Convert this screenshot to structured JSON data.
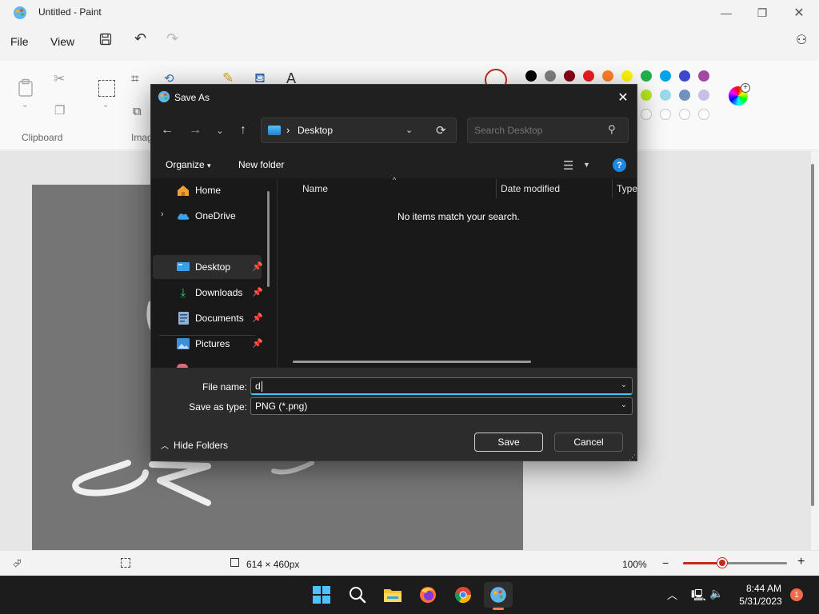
{
  "app": {
    "title": "Untitled - Paint"
  },
  "menu": {
    "file": "File",
    "view": "View"
  },
  "ribbon": {
    "clipboard_label": "Clipboard",
    "image_label": "Imag",
    "palette_row1": [
      "#000000",
      "#7f7f7f",
      "#880015",
      "#ed1c24",
      "#ff7f27",
      "#fff200",
      "#22b14c",
      "#00a2e8",
      "#3f48cc",
      "#a349a4"
    ],
    "palette_row2": [
      "#b5e61d",
      "#99d9ea",
      "#7092be",
      "#c8bfe7"
    ]
  },
  "status": {
    "canvas_size": "614 × 460px",
    "zoom": "100%",
    "zoom_level": 0.38
  },
  "dialog": {
    "title": "Save As",
    "address": {
      "location": "Desktop",
      "separator": "›"
    },
    "search_placeholder": "Search Desktop",
    "organize": "Organize",
    "new_folder": "New folder",
    "help": "?",
    "nav_items": [
      {
        "label": "Home",
        "icon": "home-icon"
      },
      {
        "label": "OneDrive",
        "icon": "cloud-icon"
      },
      {
        "label": "Desktop",
        "icon": "desktop-icon",
        "pinned": true,
        "selected": true
      },
      {
        "label": "Downloads",
        "icon": "download-icon",
        "pinned": true
      },
      {
        "label": "Documents",
        "icon": "document-icon",
        "pinned": true
      },
      {
        "label": "Pictures",
        "icon": "picture-icon",
        "pinned": true
      }
    ],
    "columns": {
      "name": "Name",
      "date_modified": "Date modified",
      "type": "Type"
    },
    "empty_message": "No items match your search.",
    "file_name_label": "File name:",
    "file_name_value": "d",
    "save_type_label": "Save as type:",
    "save_type_value": "PNG (*.png)",
    "hide_folders": "Hide Folders",
    "save": "Save",
    "cancel": "Cancel"
  },
  "taskbar": {
    "time": "8:44 AM",
    "date": "5/31/2023",
    "notifications": "1"
  }
}
